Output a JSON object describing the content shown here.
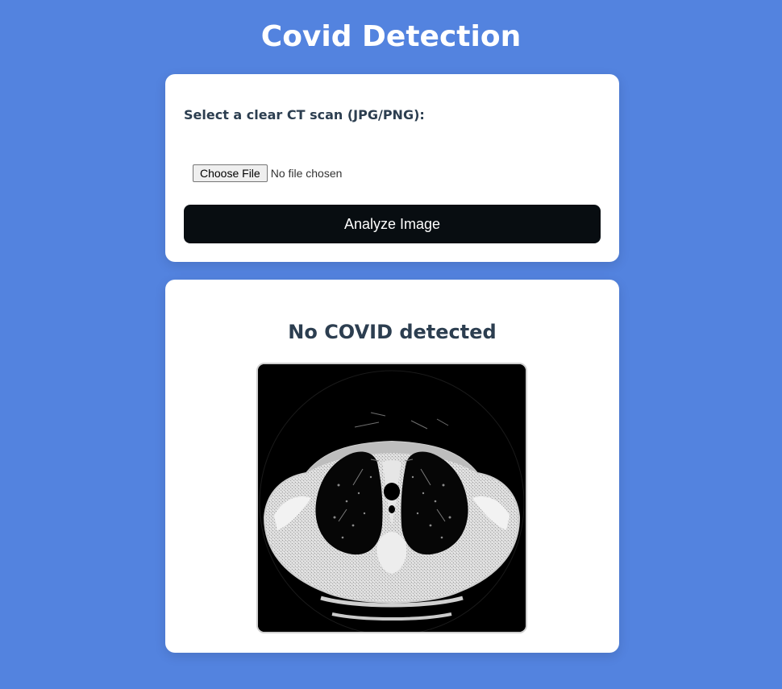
{
  "header": {
    "title": "Covid Detection"
  },
  "upload": {
    "label": "Select a clear CT scan (JPG/PNG):",
    "choose_file_label": "Choose File",
    "file_status": "No file chosen",
    "analyze_label": "Analyze Image"
  },
  "result": {
    "heading": "No COVID detected",
    "image_alt": "ct-scan-image"
  },
  "colors": {
    "background": "#5383df",
    "card": "#ffffff",
    "button": "#080d11",
    "text": "#2c3e50"
  }
}
